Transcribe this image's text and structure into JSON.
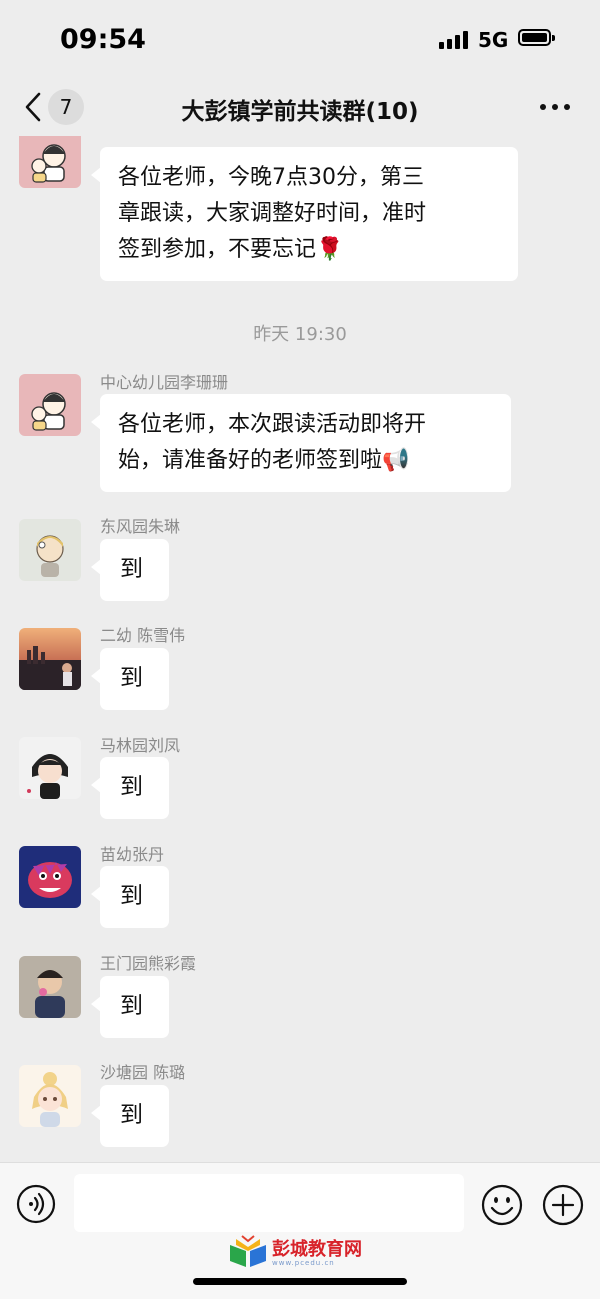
{
  "status_bar": {
    "time": "09:54",
    "network": "5G"
  },
  "nav": {
    "back_count": "7",
    "title": "大彭镇学前共读群(10)"
  },
  "messages": [
    {
      "sender": "",
      "lines": [
        "各位老师，今晚7点30分，第三",
        "章跟读，大家调整好时间，准时",
        "签到参加，不要忘记🌹"
      ]
    },
    {
      "sender": "中心幼儿园李珊珊",
      "lines": [
        "各位老师，本次跟读活动即将开",
        "始，请准备好的老师签到啦📢"
      ]
    },
    {
      "sender": "东风园朱琳",
      "text": "到"
    },
    {
      "sender": "二幼 陈雪伟",
      "text": "到"
    },
    {
      "sender": "马林园刘凤",
      "text": "到"
    },
    {
      "sender": "苗幼张丹",
      "text": "到"
    },
    {
      "sender": "王门园熊彩霞",
      "text": "到"
    },
    {
      "sender": "沙塘园 陈璐",
      "text": "到"
    }
  ],
  "divider": {
    "time": "昨天 19:30"
  },
  "input": {
    "placeholder": ""
  },
  "watermark": {
    "text": "彭城教育网",
    "sub": "www.pcedu.cn"
  },
  "icons": {
    "back": "chevron-left-icon",
    "more": "more-icon",
    "voice": "voice-icon",
    "emoji": "emoji-icon",
    "plus": "plus-icon"
  },
  "colors": {
    "background": "#ededed",
    "bubble": "#ffffff",
    "sender": "#8a8a8a",
    "watermark": "#d8232a"
  }
}
